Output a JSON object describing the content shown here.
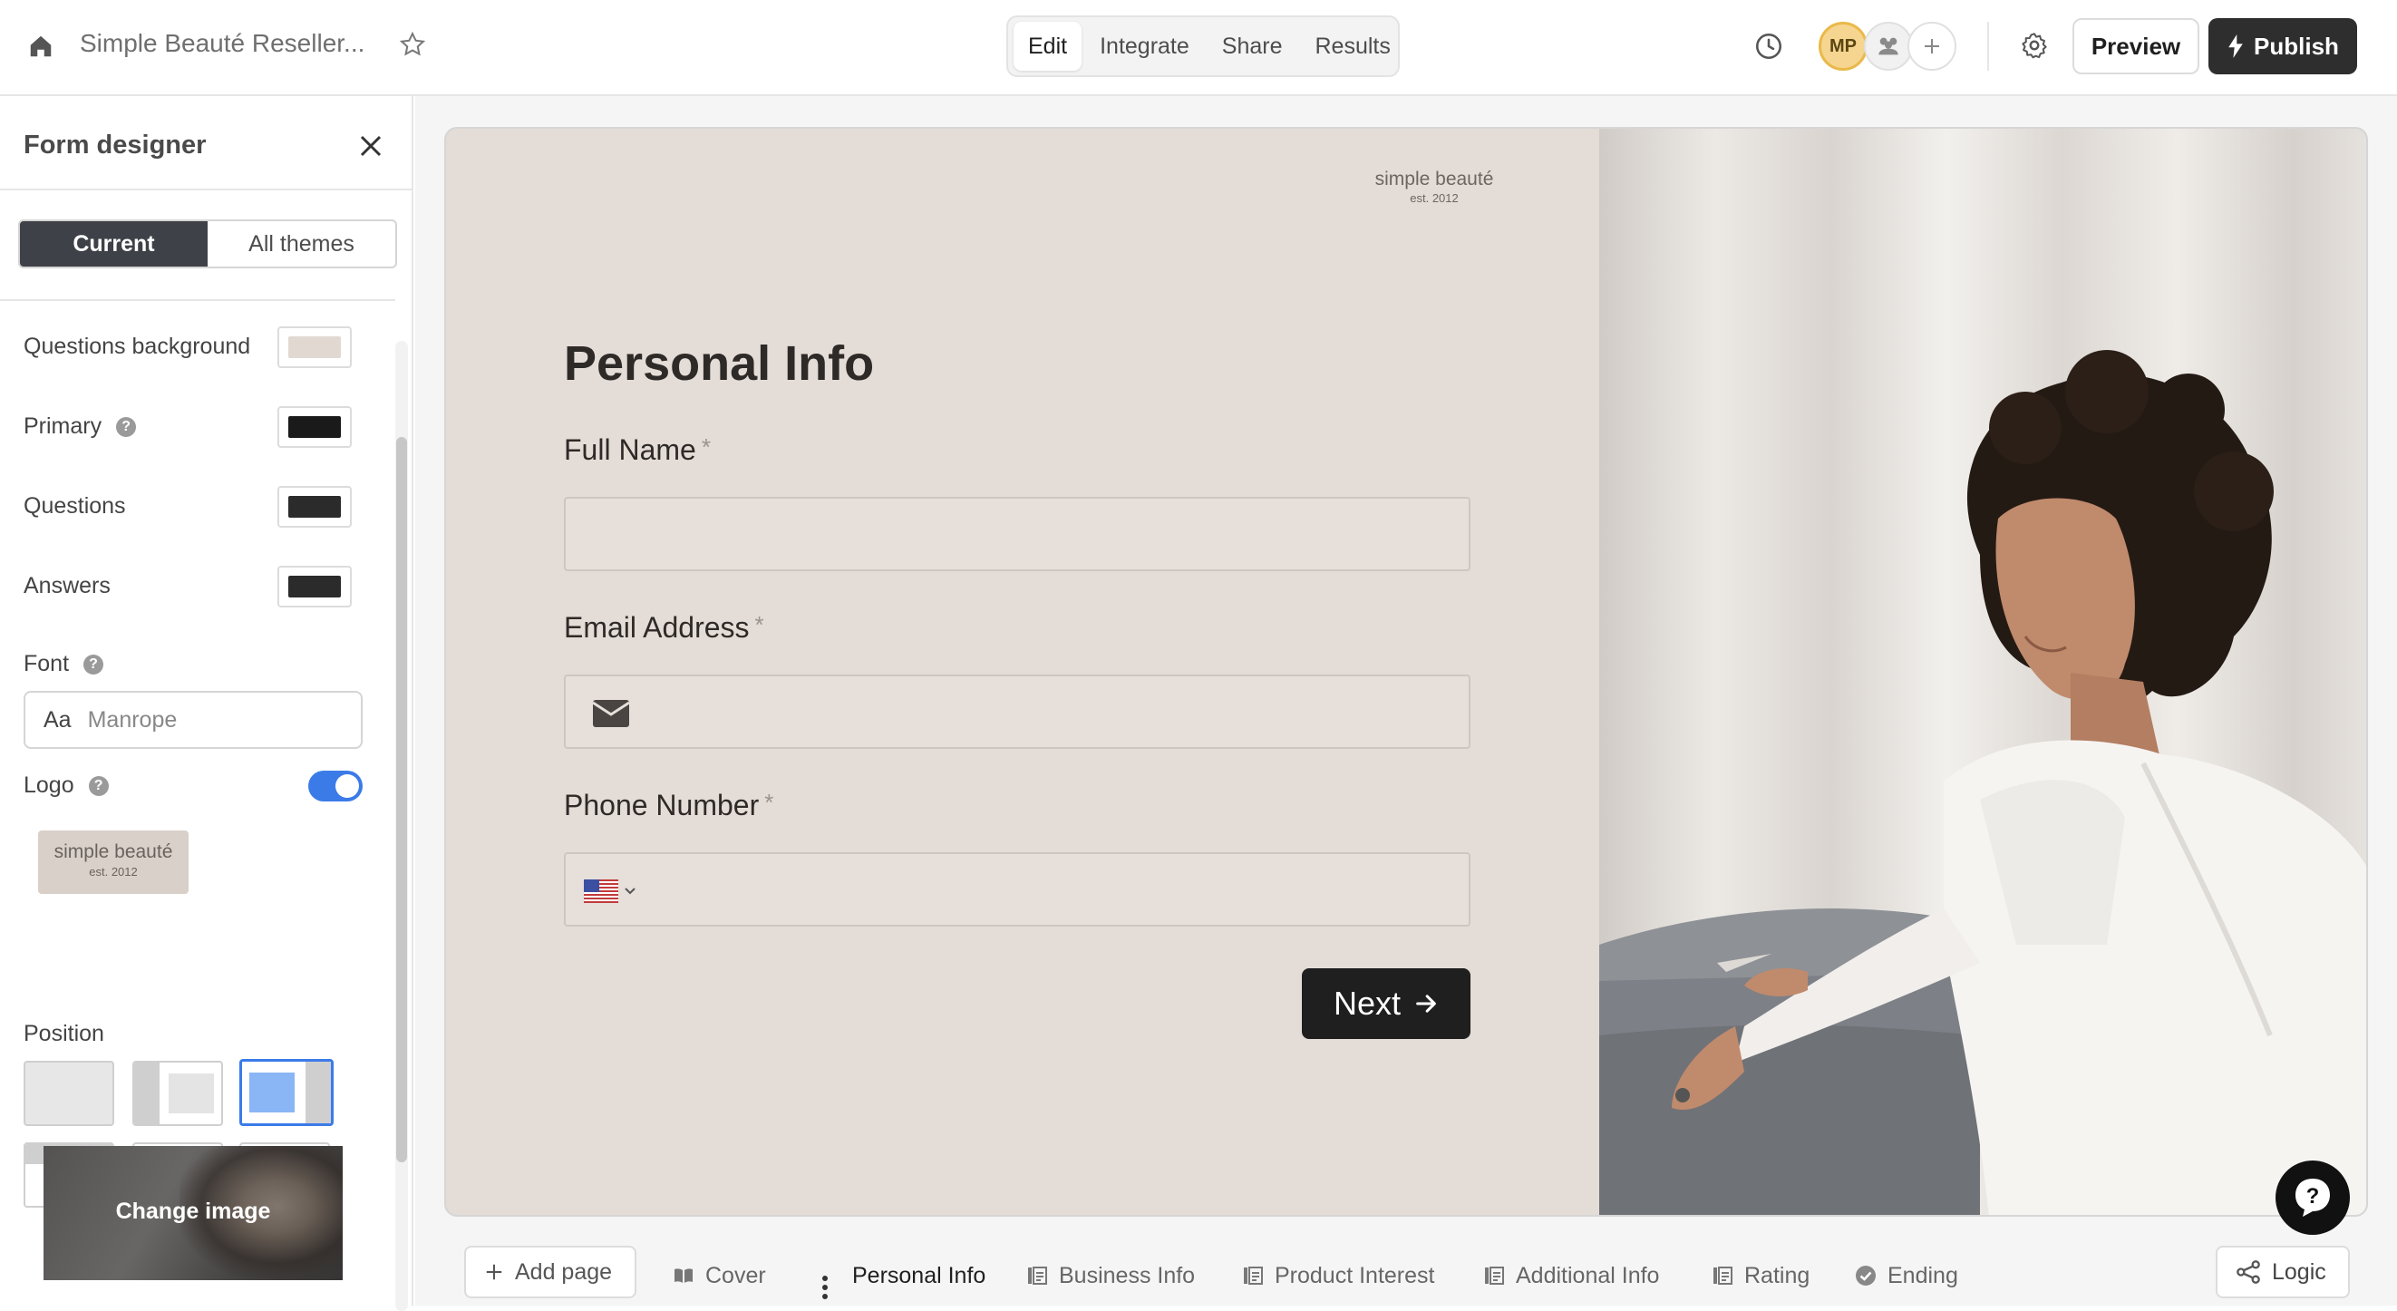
{
  "header": {
    "doc_title": "Simple Beauté Reseller...",
    "nav_tabs": [
      {
        "label": "Edit",
        "active": true
      },
      {
        "label": "Integrate",
        "active": false
      },
      {
        "label": "Share",
        "active": false
      },
      {
        "label": "Results",
        "active": false
      }
    ],
    "avatar_initials": "MP",
    "preview_label": "Preview",
    "publish_label": "Publish"
  },
  "sidebar": {
    "title": "Form designer",
    "tabs": [
      {
        "label": "Current",
        "active": true
      },
      {
        "label": "All themes",
        "active": false
      }
    ],
    "colors": [
      {
        "label": "Questions background",
        "color": "#e1d8d2"
      },
      {
        "label": "Primary",
        "color": "#1a1a1a"
      },
      {
        "label": "Questions",
        "color": "#2b2b2b"
      },
      {
        "label": "Answers",
        "color": "#2b2b2b"
      }
    ],
    "font_label": "Font",
    "font_prefix": "Aa",
    "font_value": "Manrope",
    "logo_label": "Logo",
    "logo_enabled": true,
    "logo_text": "simple beauté",
    "logo_subtext": "est. 2012",
    "position_label": "Position",
    "change_image_label": "Change image"
  },
  "form": {
    "brand": "simple beauté",
    "brand_sub": "est. 2012",
    "heading": "Personal Info",
    "fields": [
      {
        "label": "Full Name",
        "required": "*"
      },
      {
        "label": "Email Address",
        "required": "*"
      },
      {
        "label": "Phone Number",
        "required": "*"
      }
    ],
    "next_label": "Next"
  },
  "pages": {
    "add_label": "Add page",
    "items": [
      {
        "label": "Cover"
      },
      {
        "label": "Personal Info"
      },
      {
        "label": "Business Info"
      },
      {
        "label": "Product Interest"
      },
      {
        "label": "Additional Info"
      },
      {
        "label": "Rating"
      },
      {
        "label": "Ending"
      }
    ],
    "logic_label": "Logic"
  },
  "theme": {
    "accent": "#3b7be8",
    "dark": "#2e2e2e",
    "form_bg": "#e4dcd6"
  }
}
